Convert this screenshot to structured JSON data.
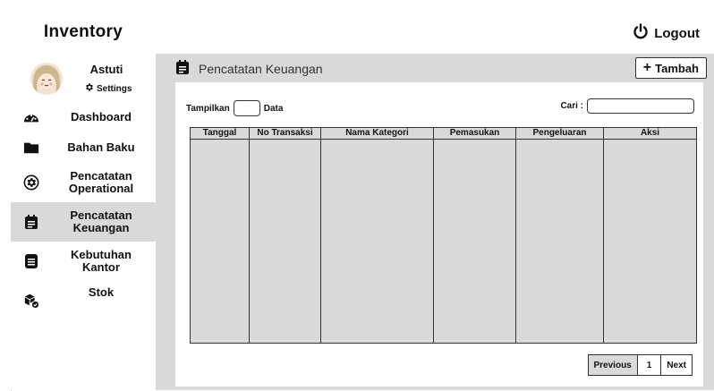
{
  "app": {
    "title": "Inventory"
  },
  "user": {
    "name": "Astuti",
    "settings_label": "Settings"
  },
  "sidebar": {
    "items": [
      {
        "label": "Dashboard",
        "icon": "gauge-icon"
      },
      {
        "label": "Bahan Baku",
        "icon": "folder-icon"
      },
      {
        "label": "Pencatatan Operational",
        "icon": "gear-icon"
      },
      {
        "label": "Pencatatan Keuangan",
        "icon": "clipboard-icon",
        "active": true
      },
      {
        "label": "Kebutuhan Kantor",
        "icon": "document-icon"
      },
      {
        "label": "Stok",
        "icon": "boxes-icon"
      }
    ]
  },
  "header": {
    "logout_label": "Logout"
  },
  "page": {
    "title": "Pencatatan Keuangan",
    "add_label": "Tambah"
  },
  "table_tools": {
    "show_label": "Tampilkan",
    "data_label": "Data",
    "search_label": "Cari :",
    "search_value": ""
  },
  "table": {
    "columns": [
      "Tanggal",
      "No Transaksi",
      "Nama Kategori",
      "Pemasukan",
      "Pengeluaran",
      "Aksi"
    ]
  },
  "pagination": {
    "previous": "Previous",
    "current_page": "1",
    "next": "Next"
  },
  "colors": {
    "panel": "#d9d9d9",
    "active_item": "#d9d9d9"
  }
}
